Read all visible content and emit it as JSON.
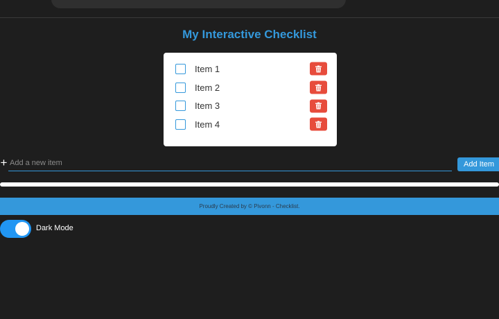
{
  "header": {
    "title": "My Interactive Checklist"
  },
  "checklist": {
    "items": [
      {
        "label": "Item 1",
        "checked": false
      },
      {
        "label": "Item 2",
        "checked": false
      },
      {
        "label": "Item 3",
        "checked": false
      },
      {
        "label": "Item 4",
        "checked": false
      }
    ],
    "delete_icon": "trash-icon"
  },
  "add_item": {
    "icon": "plus-icon",
    "placeholder": "Add a new item",
    "value": "",
    "button_label": "Add Item"
  },
  "progress": {
    "checked": 0,
    "total": 4
  },
  "footer": {
    "text": "Proudly Created by © Pivonn - Checklist."
  },
  "theme_toggle": {
    "label": "Dark Mode",
    "on": true
  },
  "colors": {
    "accent": "#3498db",
    "delete": "#e74c3c",
    "toggle": "#2196f3",
    "background": "#1e1e1e"
  }
}
